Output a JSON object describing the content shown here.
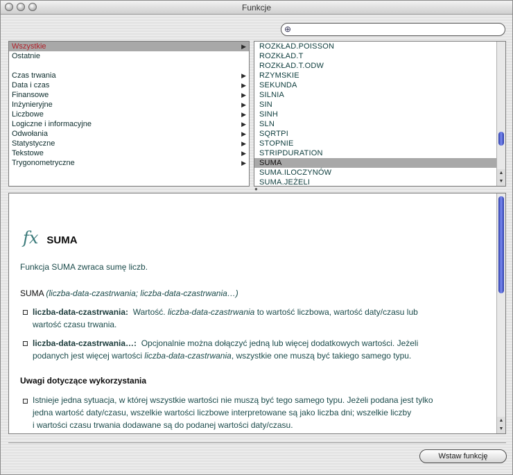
{
  "window": {
    "title": "Funkcje"
  },
  "search": {
    "placeholder": "",
    "value": ""
  },
  "categories": {
    "top": [
      {
        "label": "Wszystkie",
        "selected": true
      },
      {
        "label": "Ostatnie",
        "selected": false
      }
    ],
    "groups": [
      {
        "label": "Czas trwania"
      },
      {
        "label": "Data i czas"
      },
      {
        "label": "Finansowe"
      },
      {
        "label": "Inżynieryjne"
      },
      {
        "label": "Liczbowe"
      },
      {
        "label": "Logiczne i informacyjne"
      },
      {
        "label": "Odwołania"
      },
      {
        "label": "Statystyczne"
      },
      {
        "label": "Tekstowe"
      },
      {
        "label": "Trygonometryczne"
      }
    ]
  },
  "functions": [
    "ROZKŁAD.POISSON",
    "ROZKŁAD.T",
    "ROZKŁAD.T.ODW",
    "RZYMSKIE",
    "SEKUNDA",
    "SILNIA",
    "SIN",
    "SINH",
    "SLN",
    "SQRTPI",
    "STOPNIE",
    "STRIPDURATION",
    "SUMA",
    "SUMA.ILOCZYNÓW",
    "SUMA.JEŻELI"
  ],
  "selected_function": "SUMA",
  "description": {
    "fx": "fx",
    "name": "SUMA",
    "summary": "Funkcja SUMA zwraca sumę liczb.",
    "syntax_fn": "SUMA",
    "syntax_args": "(liczba-data-czastrwania; liczba-data-czastrwania…)",
    "arg1_name": "liczba-data-czastrwania:",
    "arg1_text_a": "Wartość.",
    "arg1_text_i": "liczba-data-czastrwania",
    "arg1_text_b": "to wartość liczbowa, wartość daty/czasu lub",
    "arg1_text_c": "wartość czasu trwania.",
    "arg2_name": "liczba-data-czastrwania…:",
    "arg2_text_a": "Opcjonalnie można dołączyć jedną lub więcej dodatkowych wartości. Jeżeli",
    "arg2_text_b": "podanych jest więcej wartości",
    "arg2_text_i": "liczba-data-czastrwania",
    "arg2_text_c": ", wszystkie one muszą być takiego samego typu.",
    "usage_heading": "Uwagi dotyczące wykorzystania",
    "usage_1": "Istnieje jedna sytuacja, w której wszystkie wartości nie muszą być tego samego typu. Jeżeli podana jest tylko",
    "usage_2": "jedna wartość daty/czasu, wszelkie wartości liczbowe interpretowane są jako liczba dni; wszelkie liczby",
    "usage_3": "i wartości czasu trwania dodawane są do podanej wartości daty/czasu."
  },
  "footer": {
    "insert_button": "Wstaw funkcję"
  }
}
